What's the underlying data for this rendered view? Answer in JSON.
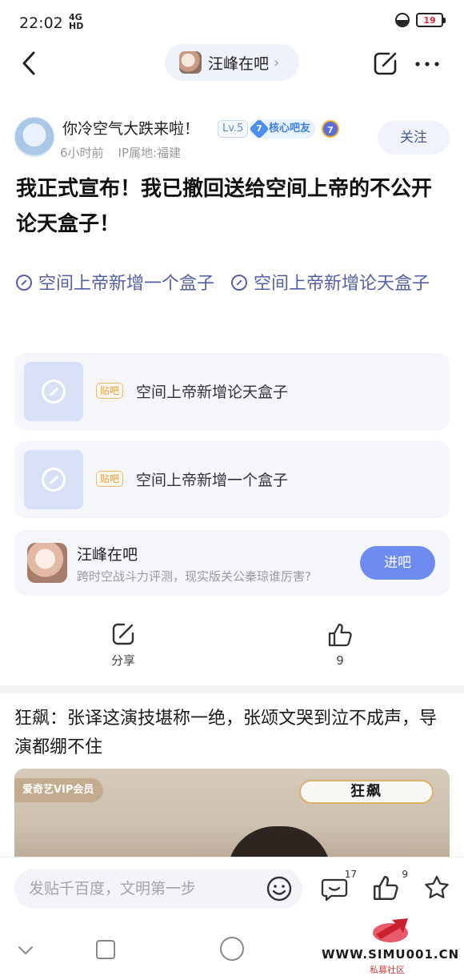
{
  "status_bar": {
    "time": "22:02",
    "network": "4G",
    "network_sub": "HD",
    "battery": "19"
  },
  "header": {
    "forum_name": "汪峰在吧",
    "chevron": "›"
  },
  "author": {
    "name": "你冷空气大跌来啦！",
    "level": "Lv.5",
    "core_level": "7",
    "core_badge": "核心吧友",
    "crown_num": "7",
    "time_ago": "6小时前",
    "ip": "IP属地:福建",
    "follow_label": "关注"
  },
  "post": {
    "title": "我正式宣布！我已撤回送给空间上帝的不公开论天盒子！",
    "topic_links": [
      "空间上帝新增一个盒子",
      "空间上帝新增论天盒子"
    ],
    "link_cards": [
      {
        "tag": "贴吧",
        "text": "空间上帝新增论天盒子"
      },
      {
        "tag": "贴吧",
        "text": "空间上帝新增一个盒子"
      }
    ],
    "forum_card": {
      "name": "汪峰在吧",
      "desc": "跨时空战斗力评测，现实版关公秦琼谁厉害?",
      "enter_label": "进吧"
    },
    "share_label": "分享",
    "like_count": "9"
  },
  "feed": {
    "title": "狂飙：张译这演技堪称一绝，张颂文哭到泣不成声，导演都绷不住",
    "vip_tag": "爱奇艺VIP会员",
    "show_logo": "狂飙"
  },
  "bottom_bar": {
    "placeholder": "发贴千百度，文明第一步",
    "comment_count": "17",
    "like_count": "9"
  },
  "watermark": {
    "text": "WWW.SIMU001.CN",
    "sub": "私募社区"
  }
}
